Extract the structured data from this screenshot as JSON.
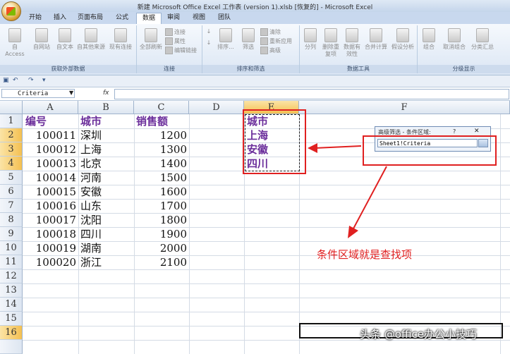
{
  "window": {
    "title": "新建 Microsoft Office Excel 工作表 (version 1).xlsb [恢复的] - Microsoft Excel"
  },
  "tabs": [
    "开始",
    "插入",
    "页面布局",
    "公式",
    "数据",
    "审阅",
    "视图",
    "团队"
  ],
  "active_tab": "数据",
  "ribbon": {
    "get_external": {
      "name": "获取外部数据",
      "buttons": [
        "自 Access",
        "自网站",
        "自文本",
        "自其他来源",
        "现有连接"
      ]
    },
    "connections": {
      "name": "连接",
      "refresh": "全部刷新",
      "items": [
        "连接",
        "属性",
        "编辑链接"
      ]
    },
    "sort_filter": {
      "name": "排序和筛选",
      "sort": "排序...",
      "filter": "筛选",
      "items": [
        "清除",
        "重新应用",
        "高级"
      ]
    },
    "data_tools": {
      "name": "数据工具",
      "buttons": [
        "分列",
        "删除重复项",
        "数据有效性",
        "合并计算",
        "假设分析"
      ]
    },
    "outline": {
      "name": "分级显示",
      "buttons": [
        "组合",
        "取消组合",
        "分类汇总"
      ]
    }
  },
  "formula_bar": {
    "name_box": "Criteria",
    "fx": "fx"
  },
  "columns": [
    "A",
    "B",
    "C",
    "D",
    "E",
    "F"
  ],
  "rows": [
    "1",
    "2",
    "3",
    "4",
    "5",
    "6",
    "7",
    "8",
    "9",
    "10",
    "11",
    "12",
    "13",
    "14",
    "15",
    "16"
  ],
  "table": {
    "headers": [
      "编号",
      "城市",
      "销售额"
    ],
    "data": [
      [
        "100011",
        "深圳",
        "1200"
      ],
      [
        "100012",
        "上海",
        "1300"
      ],
      [
        "100013",
        "北京",
        "1400"
      ],
      [
        "100014",
        "河南",
        "1500"
      ],
      [
        "100015",
        "安徽",
        "1600"
      ],
      [
        "100016",
        "山东",
        "1700"
      ],
      [
        "100017",
        "沈阳",
        "1800"
      ],
      [
        "100018",
        "四川",
        "1900"
      ],
      [
        "100019",
        "湖南",
        "2000"
      ],
      [
        "100020",
        "浙江",
        "2100"
      ]
    ]
  },
  "criteria": [
    "城市",
    "上海",
    "安徽",
    "四川"
  ],
  "dialog": {
    "title": "高级筛选 - 条件区域:",
    "help": "?",
    "close": "✕",
    "value": "Sheet1!Criteria"
  },
  "annotation": "条件区域就是查找项",
  "watermark": "头条 @office办公小技巧",
  "colors": {
    "header_purple": "#6b2e9b",
    "annotation_red": "#e02020"
  }
}
